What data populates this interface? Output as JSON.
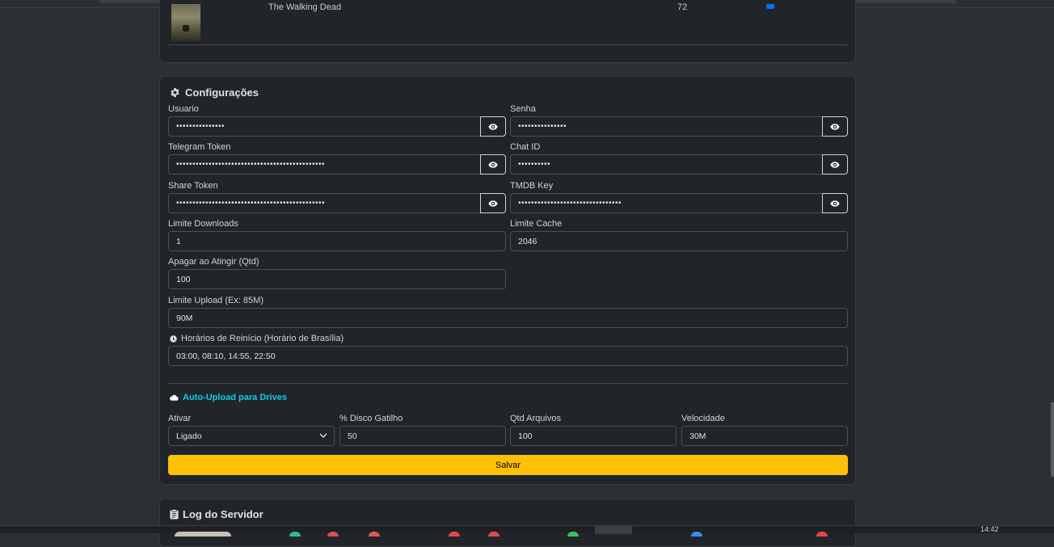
{
  "top_card": {
    "row": {
      "title": "The Walking Dead",
      "value": "72"
    }
  },
  "config": {
    "title": "Configurações",
    "usuario": {
      "label": "Usuario",
      "value": "•••••••••••••••"
    },
    "senha": {
      "label": "Senha",
      "value": "•••••••••••••••"
    },
    "telegram_token": {
      "label": "Telegram Token",
      "value": "••••••••••••••••••••••••••••••••••••••••••••••"
    },
    "chat_id": {
      "label": "Chat ID",
      "value": "••••••••••"
    },
    "share_token": {
      "label": "Share Token",
      "value": "••••••••••••••••••••••••••••••••••••••••••••••"
    },
    "tmdb_key": {
      "label": "TMDB Key",
      "value": "••••••••••••••••••••••••••••••••"
    },
    "limite_downloads": {
      "label": "Limite Downloads",
      "value": "1"
    },
    "limite_cache": {
      "label": "Limite Cache",
      "value": "2046"
    },
    "apagar": {
      "label": "Apagar ao Atingir (Qtd)",
      "value": "100"
    },
    "limite_upload": {
      "label": "Limite Upload (Ex: 85M)",
      "value": "90M"
    },
    "horarios": {
      "label": "Horários de Reinício (Horário de Brasília)",
      "value": "03:00, 08:10, 14:55, 22:50"
    },
    "auto_upload": {
      "title": "Auto-Upload para Drives",
      "ativar": {
        "label": "Ativar",
        "value": "Ligado"
      },
      "disco": {
        "label": "% Disco Gatilho",
        "value": "50"
      },
      "qtd": {
        "label": "Qtd Arquivos",
        "value": "100"
      },
      "velocidade": {
        "label": "Velocidade",
        "value": "30M"
      }
    },
    "save_label": "Salvar"
  },
  "log": {
    "title": "Log do Servidor"
  },
  "taskbar": {
    "clock": "14:42"
  },
  "colors": {
    "accent": "#ffc107",
    "info": "#0dcaf0",
    "card_bg": "#212529",
    "page_bg": "#2c2f33"
  },
  "icons": {
    "gear": "gear-icon",
    "eye": "eye-icon",
    "clock": "clock-icon",
    "cloud": "cloud-icon",
    "clipboard": "clipboard-icon"
  }
}
